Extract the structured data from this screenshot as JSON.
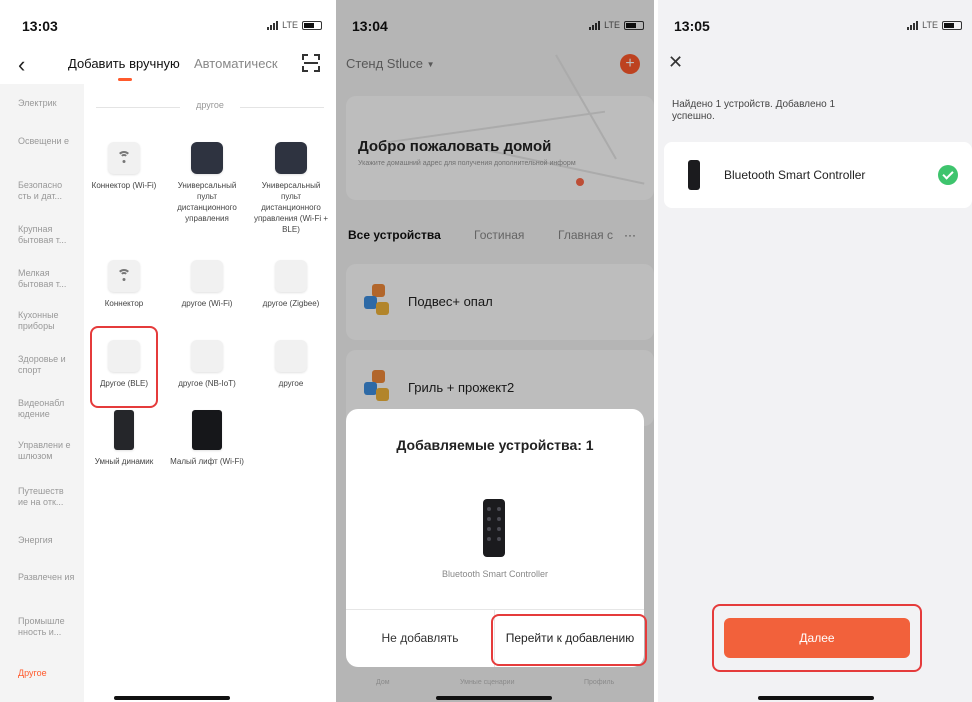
{
  "panel1": {
    "time": "13:03",
    "network": "LTE",
    "tabs": {
      "manual": "Добавить вручную",
      "auto": "Автоматическ"
    },
    "sidebar": [
      "Электрик",
      "Освещени е",
      "Безопасно сть и дат...",
      "Крупная бытовая т...",
      "Мелкая бытовая т...",
      "Кухонные приборы",
      "Здоровье и спорт",
      "Видеонабл юдение",
      "Управлени е шлюзом",
      "Путешеств ие на отк...",
      "Энергия",
      "Развлечен ия",
      "Промышле нность и...",
      "Другое"
    ],
    "section_title": "другое",
    "devices": [
      {
        "label": "Коннектор (Wi-Fi)",
        "icon": "wifi-icon"
      },
      {
        "label": "Универсальный пульт дистанционного управления",
        "icon": "remote-hub-icon"
      },
      {
        "label": "Универсальный пульт дистанционного управления (Wi-Fi + BLE)",
        "icon": "remote-hub-icon"
      },
      {
        "label": "Коннектор",
        "icon": "wifi-icon"
      },
      {
        "label": "другое (Wi-Fi)",
        "icon": "device-icon"
      },
      {
        "label": "другое (Zigbee)",
        "icon": "device-icon"
      },
      {
        "label": "Другое (BLE)",
        "icon": "device-icon"
      },
      {
        "label": "другое (NB-IoT)",
        "icon": "device-icon"
      },
      {
        "label": "другое",
        "icon": "device-icon"
      },
      {
        "label": "Умный динамик",
        "icon": "speaker-icon"
      },
      {
        "label": "Малый лифт (Wi-Fi)",
        "icon": "lift-icon"
      }
    ]
  },
  "panel2": {
    "time": "13:04",
    "network": "LTE",
    "home_name": "Стенд Stluce",
    "welcome_title": "Добро пожаловать домой",
    "welcome_subtitle": "Укажите домашний адрес для получения дополнительной информ",
    "room_tabs": {
      "all": "Все устройства",
      "room2": "Гостиная",
      "room3": "Главная с",
      "more": "···"
    },
    "devices": [
      "Подвес+ опал",
      "Гриль + прожект2"
    ],
    "modal": {
      "title": "Добавляемые устройства: 1",
      "device_name": "Bluetooth Smart Controller",
      "btn_cancel": "Не добавлять",
      "btn_go": "Перейти к добавлению"
    },
    "tabbar": {
      "home": "Дом",
      "scenes": "Умные сценарии",
      "profile": "Профиль"
    }
  },
  "panel3": {
    "time": "13:05",
    "network": "LTE",
    "found_text": "Найдено 1 устройств. Добавлено 1 успешно.",
    "device_name": "Bluetooth Smart Controller",
    "next_button": "Далее"
  },
  "colors": {
    "accent": "#ff5a2c",
    "highlight": "#e53b3b",
    "success": "#3ec46d"
  }
}
